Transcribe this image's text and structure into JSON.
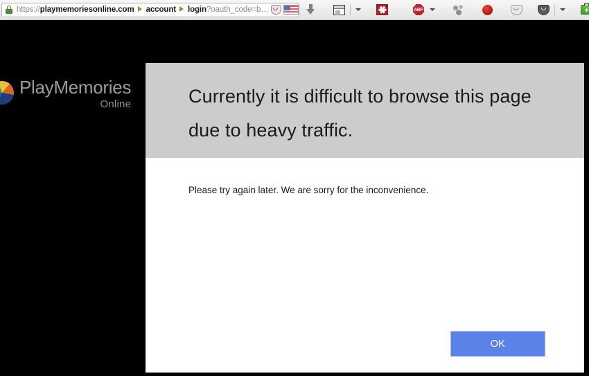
{
  "browser": {
    "urlbar": {
      "lock_icon": "lock-icon",
      "scheme": "https://",
      "host": "playmemoriesonline.com",
      "crumb_account": "account",
      "crumb_login": "login",
      "query": "?oauth_code=b…",
      "pocket_icon": "pocket-icon",
      "flag_icon": "us-flag-icon",
      "flag_caret_icon": "chevron-down-icon",
      "reload_icon": "reload-icon"
    },
    "toolbar_icons": [
      {
        "name": "downloads-icon",
        "kind": "download-arrow"
      },
      {
        "name": "reader-view-icon",
        "kind": "reader-window"
      },
      {
        "name": "reader-view-chevron-icon",
        "kind": "caret"
      },
      {
        "name": "red-asterisk-addon-icon",
        "kind": "asterisk"
      },
      {
        "name": "adblock-plus-icon",
        "kind": "abp",
        "label": "ABP"
      },
      {
        "name": "adblock-plus-chevron-icon",
        "kind": "caret"
      },
      {
        "name": "node-graph-addon-icon",
        "kind": "molecule"
      },
      {
        "name": "record-dot-icon",
        "kind": "red-dot"
      },
      {
        "name": "shield-light-addon-icon",
        "kind": "shield-light"
      },
      {
        "name": "shield-dark-addon-icon",
        "kind": "shield-dark"
      },
      {
        "name": "shield-dark-chevron-icon",
        "kind": "caret"
      },
      {
        "name": "toolbox-addon-icon",
        "kind": "toolbox"
      },
      {
        "name": "toolbox-chevron-icon",
        "kind": "caret"
      },
      {
        "name": "photo-addon-icon",
        "kind": "photo"
      },
      {
        "name": "no-entry-addon-icon",
        "kind": "no-entry"
      },
      {
        "name": "multicolor-addon-icon",
        "kind": "multicolor"
      },
      {
        "name": "ribbon-addon-icon",
        "kind": "ribbon"
      }
    ]
  },
  "page": {
    "background_color": "#000000",
    "brand": {
      "mark_icon": "playmemories-globe-icon",
      "title": "PlayMemories",
      "subtitle": "Online"
    }
  },
  "dialog": {
    "header_color": "#cccccc",
    "title": "Currently it is difficult to browse this page due to heavy traffic.",
    "message": "Please try again later. We are sorry for the inconvenience.",
    "ok_label": "OK",
    "ok_color": "#5b82e8"
  }
}
